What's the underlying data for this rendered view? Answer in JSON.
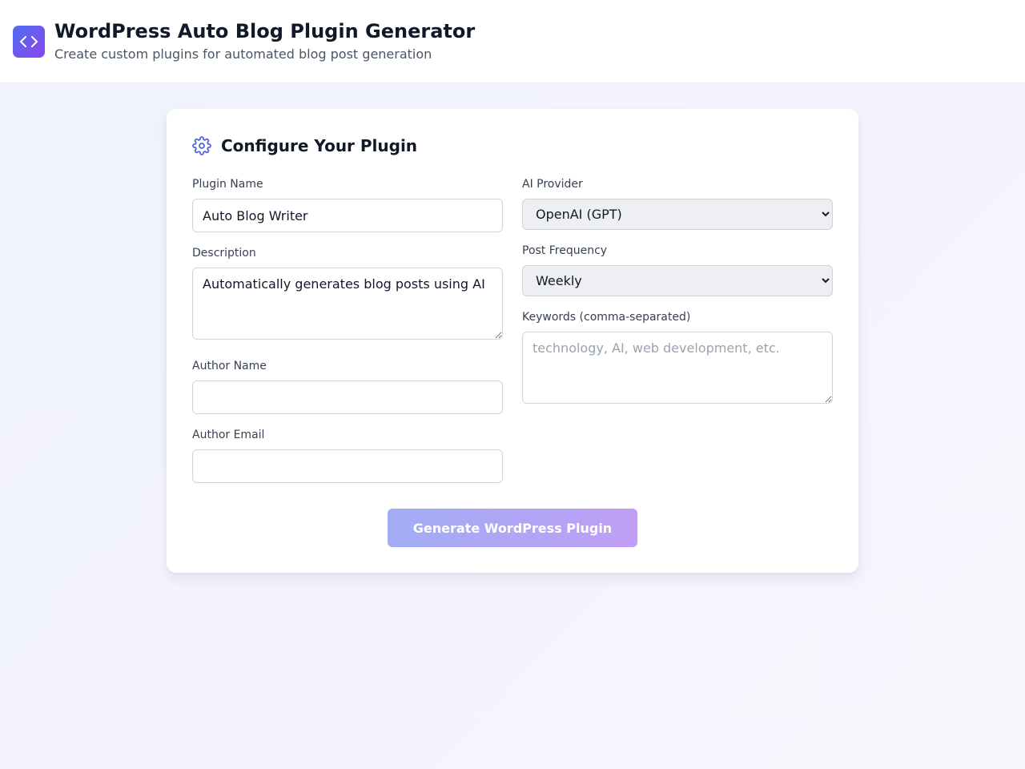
{
  "header": {
    "logo_icon": "code-brackets-icon",
    "title": "WordPress Auto Blog Plugin Generator",
    "subtitle": "Create custom plugins for automated blog post generation"
  },
  "form": {
    "heading_icon": "gear-icon",
    "title": "Configure Your Plugin",
    "plugin_name": {
      "label": "Plugin Name",
      "value": "Auto Blog Writer"
    },
    "description": {
      "label": "Description",
      "value": "Automatically generates blog posts using AI"
    },
    "author_name": {
      "label": "Author Name",
      "value": ""
    },
    "author_email": {
      "label": "Author Email",
      "value": ""
    },
    "ai_provider": {
      "label": "AI Provider",
      "selected": "OpenAI (GPT)"
    },
    "post_frequency": {
      "label": "Post Frequency",
      "selected": "Weekly"
    },
    "keywords": {
      "label": "Keywords (comma-separated)",
      "value": "",
      "placeholder": "technology, AI, web development, etc."
    },
    "generate_label": "Generate WordPress Plugin"
  },
  "colors": {
    "accent_start": "#4f6ef0",
    "accent_end": "#8b45ef",
    "button_start": "#a0adf4",
    "button_end": "#c09ef5"
  }
}
